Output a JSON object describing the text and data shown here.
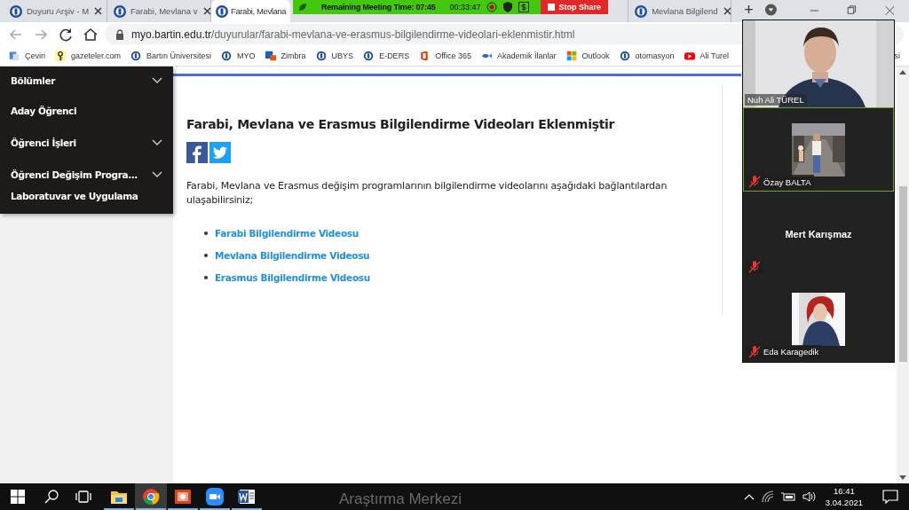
{
  "browser": {
    "tabs": [
      {
        "title": "Duyuru Arşiv - M",
        "selected": false,
        "close_button": true
      },
      {
        "title": "Farabi, Mevlana v",
        "selected": false,
        "close_button": true
      },
      {
        "title": "Farabi, Mevlana",
        "selected": true,
        "close_button": false
      },
      {
        "title": "Mevlana Bilgilend",
        "selected": false,
        "close_button": true
      }
    ],
    "new_tab": "+",
    "address": {
      "host": "myo.bartin.edu.tr",
      "path": "/duyurular/farabi-mevlana-ve-erasmus-bilgilendirme-videolari-eklenmistir.html"
    },
    "bookmarks": [
      {
        "label": "Çeviri",
        "kind": "translate"
      },
      {
        "label": "gazeteler.com",
        "kind": "key"
      },
      {
        "label": "Bartın Üniversitesi",
        "kind": "uni"
      },
      {
        "label": "MYO",
        "kind": "uni"
      },
      {
        "label": "Zimbra",
        "kind": "zimbra"
      },
      {
        "label": "UBYS",
        "kind": "uni"
      },
      {
        "label": "E-DERS",
        "kind": "uni"
      },
      {
        "label": "Office 365",
        "kind": "office"
      },
      {
        "label": "Akademik İlanlar",
        "kind": "fish"
      },
      {
        "label": "Outlook",
        "kind": "windows"
      },
      {
        "label": "otomasyon",
        "kind": "uni"
      },
      {
        "label": "Ali Turel",
        "kind": "video"
      },
      {
        "label": "si",
        "kind": "none"
      }
    ]
  },
  "sidebar": {
    "items": [
      {
        "label": "Bölümler",
        "expandable": true
      },
      {
        "label": "Aday Öğrenci",
        "expandable": false
      },
      {
        "label": "Öğrenci İşleri",
        "expandable": true
      },
      {
        "label": "Öğrenci Değişim Progra...",
        "expandable": true
      },
      {
        "label": "Laboratuvar ve Uygulama",
        "expandable": false
      }
    ]
  },
  "article": {
    "title": "Farabi, Mevlana ve Erasmus Bilgilendirme Videoları Eklenmiştir",
    "body": "Farabi, Mevlana ve Erasmus değişim programlarının bilgilendirme videolarını aşağıdaki bağlantılardan ulaşabilirsiniz;",
    "links": [
      "Farabi Bilgilendirme Videosu",
      "Mevlana Bilgilendirme Videosu",
      "Erasmus Bilgilendirme Videosu"
    ]
  },
  "footer_text": [
    "Araştırma Merkezi"
  ],
  "meeting": {
    "remaining": "Remaining Meeting Time: 07:45",
    "elapsed": "00:33:47",
    "stop_share": "Stop Share",
    "participants": [
      {
        "name": "Nuh Ali TÜREL",
        "kind": "video",
        "muted": false,
        "speaking": false
      },
      {
        "name": "Özay BALTA",
        "muted": true,
        "speaking": true
      },
      {
        "name": "Mert Karışmaz",
        "kind": "name",
        "muted": true,
        "speaking": false
      },
      {
        "name": "Eda Karagedik",
        "muted": true,
        "speaking": false
      }
    ]
  },
  "taskbar": {
    "apps": [
      {
        "kind": "explorer",
        "active": false
      },
      {
        "kind": "chrome",
        "active": true
      },
      {
        "kind": "powerpoint",
        "active": false
      },
      {
        "kind": "zoom",
        "active": false
      },
      {
        "kind": "word",
        "active": false
      }
    ],
    "time": "16:41",
    "date": "3.04.2021"
  }
}
